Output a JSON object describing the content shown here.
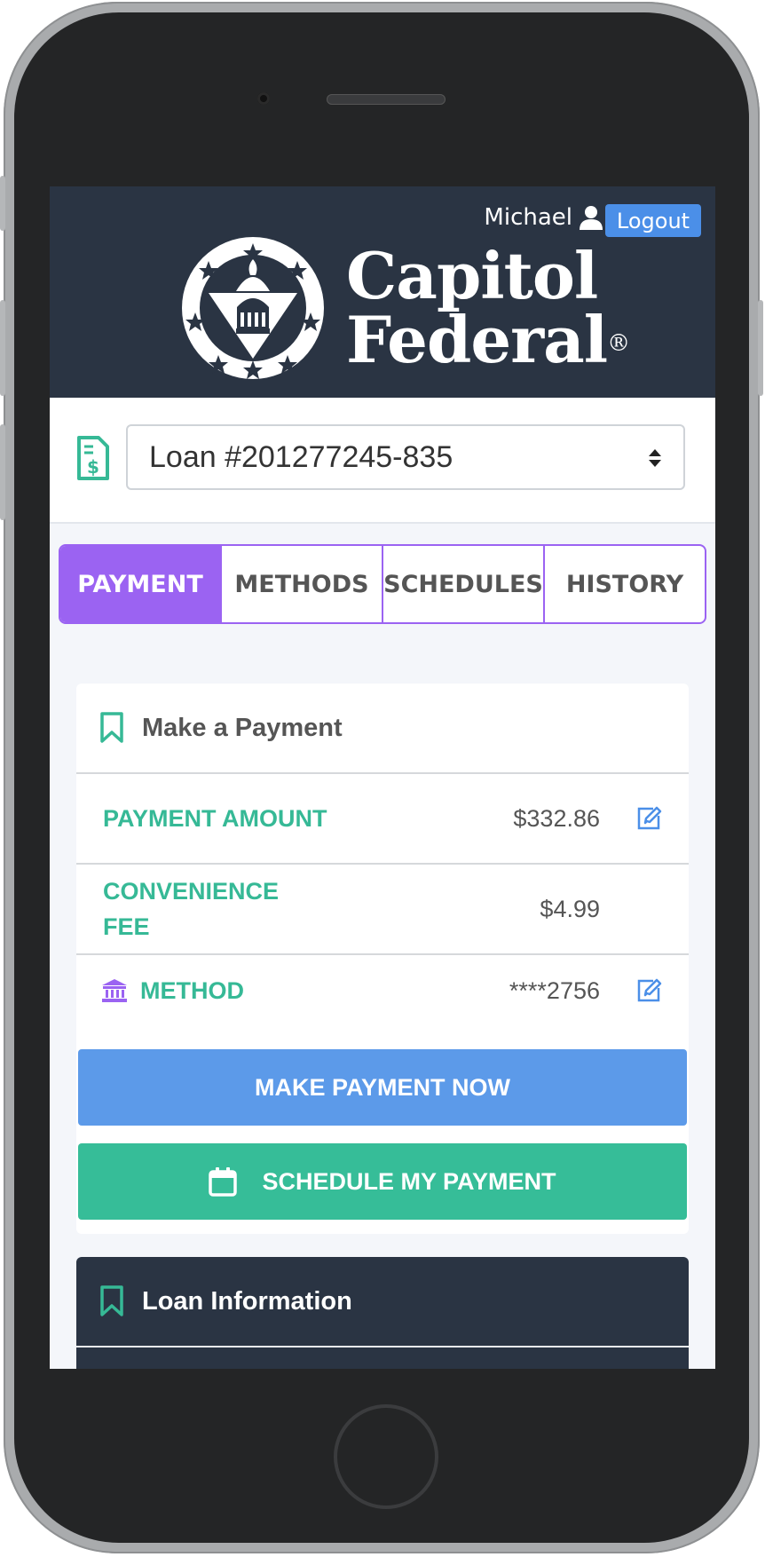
{
  "header": {
    "username": "Michael",
    "logout_label": "Logout",
    "brand_line1": "Capitol",
    "brand_line2": "Federal",
    "brand_mark": "®"
  },
  "loan_select": {
    "value": "Loan #201277245-835",
    "icon": "invoice-dollar-icon"
  },
  "tabs": [
    {
      "label": "PAYMENT",
      "active": true
    },
    {
      "label": "METHODS",
      "active": false
    },
    {
      "label": "SCHEDULES",
      "active": false
    },
    {
      "label": "HISTORY",
      "active": false
    }
  ],
  "payment_card": {
    "title": "Make a Payment",
    "rows": [
      {
        "label": "PAYMENT AMOUNT",
        "value": "$332.86"
      },
      {
        "label_line1": "CONVENIENCE",
        "label_line2": "FEE",
        "value": "$4.99"
      },
      {
        "label": "METHOD",
        "value": "****2756"
      }
    ],
    "make_payment_label": "MAKE PAYMENT NOW",
    "schedule_label": "SCHEDULE MY PAYMENT"
  },
  "info_card": {
    "title": "Loan Information"
  },
  "colors": {
    "header_bg": "#2a3443",
    "accent_purple": "#9b63f2",
    "accent_green": "#36b996",
    "button_blue": "#5c9ae9",
    "button_green": "#36bd98"
  }
}
